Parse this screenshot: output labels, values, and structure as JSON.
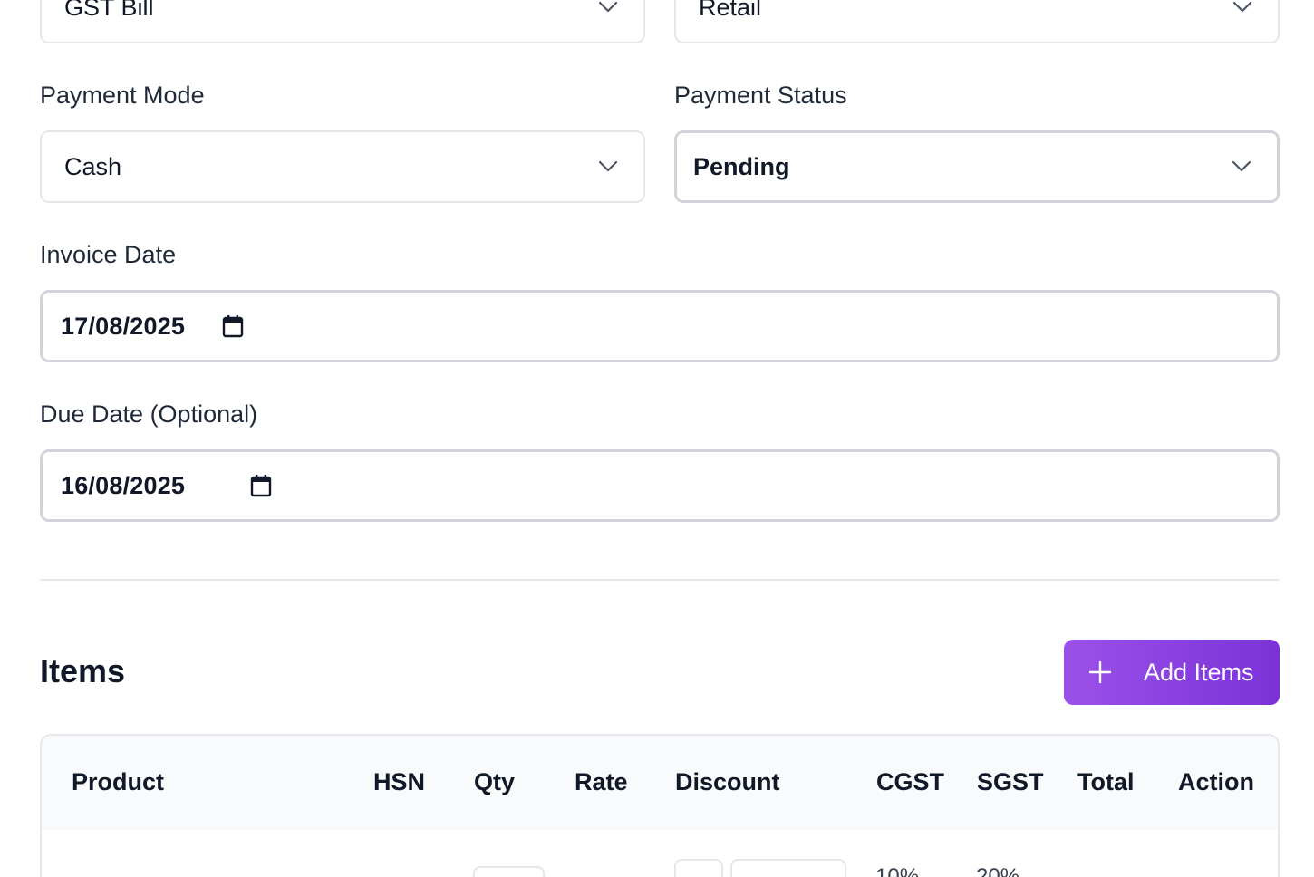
{
  "top_row": {
    "bill_type_value": "GST Bill",
    "customer_type_value": "Retail"
  },
  "payment_mode": {
    "label": "Payment Mode",
    "value": "Cash"
  },
  "payment_status": {
    "label": "Payment Status",
    "value": "Pending"
  },
  "invoice_date": {
    "label": "Invoice Date",
    "value": "17/08/2025"
  },
  "due_date": {
    "label": "Due Date (Optional)",
    "value": "16/08/2025"
  },
  "items": {
    "title": "Items",
    "add_button_label": "Add Items",
    "columns": [
      "Product",
      "HSN",
      "Qty",
      "Rate",
      "Discount",
      "CGST",
      "SGST",
      "Total",
      "Action"
    ],
    "row_cgst": "10%",
    "row_sgst": "20%"
  },
  "colors": {
    "accent_start": "#9b51e8",
    "accent_end": "#7b32d8"
  }
}
